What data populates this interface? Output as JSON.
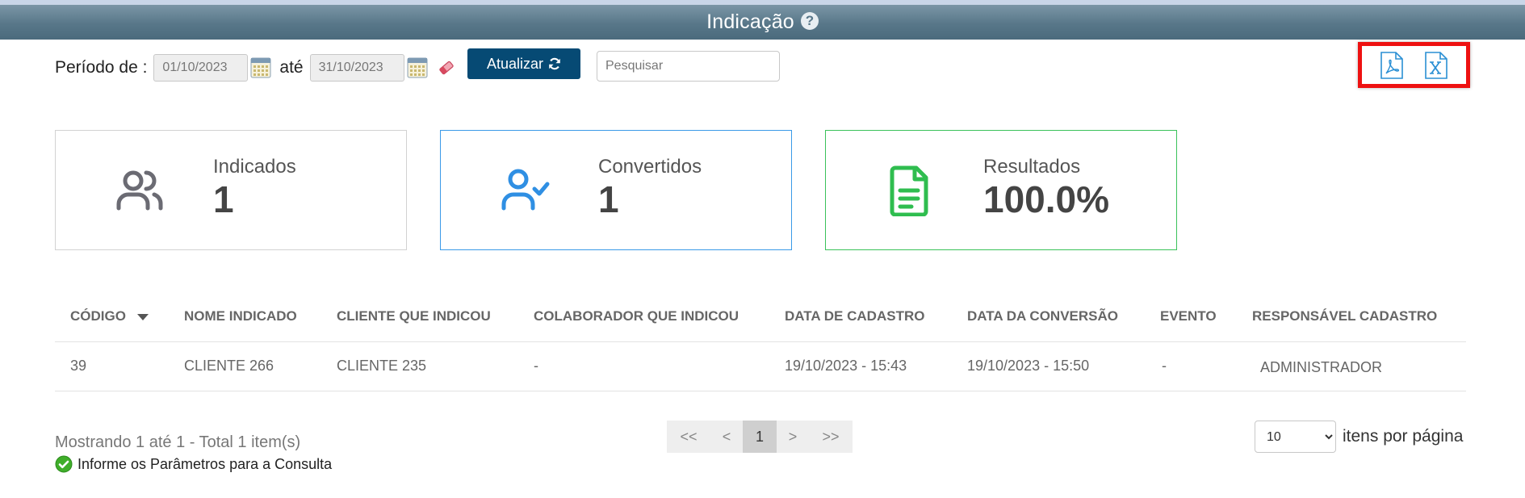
{
  "header": {
    "title": "Indicação",
    "help_glyph": "?"
  },
  "filters": {
    "period_label": "Período de :",
    "date_from": "01/10/2023",
    "until_label": "até",
    "date_to": "31/10/2023",
    "update_label": "Atualizar",
    "search_placeholder": "Pesquisar"
  },
  "export": {
    "pdf_icon": "pdf-file-icon",
    "excel_icon": "excel-file-icon"
  },
  "cards": [
    {
      "label": "Indicados",
      "value": "1",
      "icon": "users-icon",
      "border_color": "#d2d2d2",
      "icon_color": "#6b6b73"
    },
    {
      "label": "Convertidos",
      "value": "1",
      "icon": "user-check-icon",
      "border_color": "#3a9ae8",
      "icon_color": "#2f8fe3"
    },
    {
      "label": "Resultados",
      "value": "100.0%",
      "icon": "document-icon",
      "border_color": "#3ac25a",
      "icon_color": "#2fbd4f"
    }
  ],
  "table": {
    "columns": [
      "CÓDIGO",
      "NOME INDICADO",
      "CLIENTE QUE INDICOU",
      "COLABORADOR QUE INDICOU",
      "DATA DE CADASTRO",
      "DATA DA CONVERSÃO",
      "EVENTO",
      "RESPONSÁVEL CADASTRO"
    ],
    "rows": [
      [
        "39",
        "CLIENTE 266",
        "CLIENTE 235",
        "-",
        "19/10/2023 - 15:43",
        "19/10/2023 - 15:50",
        "-",
        "ADMINISTRADOR"
      ]
    ]
  },
  "footer": {
    "count_text": "Mostrando 1 até 1 - Total 1 item(s)",
    "info_text": "Informe os Parâmetros para a Consulta"
  },
  "pagination": {
    "first": "<<",
    "prev": "<",
    "current": "1",
    "next": ">",
    "last": ">>"
  },
  "page_size": {
    "selected": "10",
    "label": "itens por página"
  },
  "colors": {
    "header_bar": "#587789",
    "update_button": "#064a74",
    "export_highlight": "#ee1111"
  }
}
